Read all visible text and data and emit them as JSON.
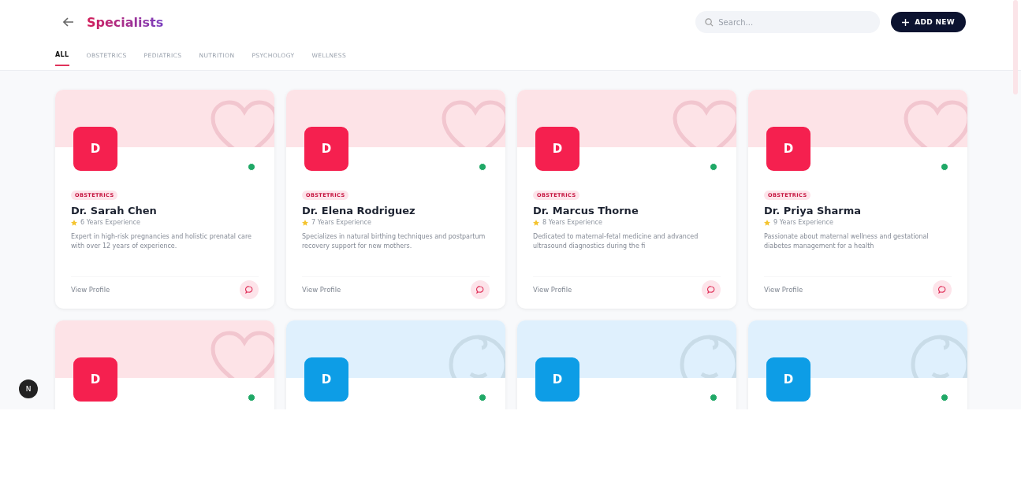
{
  "header": {
    "title": "Specialists",
    "search": {
      "placeholder": "Search..."
    },
    "add_button": "ADD NEW"
  },
  "tabs": [
    {
      "label": "ALL",
      "selected": true
    },
    {
      "label": "OBSTETRICS",
      "selected": false
    },
    {
      "label": "PEDIATRICS",
      "selected": false
    },
    {
      "label": "NUTRITION",
      "selected": false
    },
    {
      "label": "PSYCHOLOGY",
      "selected": false
    },
    {
      "label": "WELLNESS",
      "selected": false
    }
  ],
  "cards": [
    {
      "kind": "obstetrics",
      "initial": "D",
      "online": true,
      "tag": "OBSTETRICS",
      "name": "Dr. Sarah Chen",
      "experience": "6 Years Experience",
      "description": "Expert in high-risk pregnancies and holistic prenatal care with over 12 years of experience.",
      "link": "View Profile"
    },
    {
      "kind": "obstetrics",
      "initial": "D",
      "online": true,
      "tag": "OBSTETRICS",
      "name": "Dr. Elena Rodriguez",
      "experience": "7 Years Experience",
      "description": "Specializes in natural birthing techniques and postpartum recovery support for new mothers.",
      "link": "View Profile"
    },
    {
      "kind": "obstetrics",
      "initial": "D",
      "online": true,
      "tag": "OBSTETRICS",
      "name": "Dr. Marcus Thorne",
      "experience": "8 Years Experience",
      "description": "Dedicated to maternal-fetal medicine and advanced ultrasound diagnostics during the fi",
      "link": "View Profile"
    },
    {
      "kind": "obstetrics",
      "initial": "D",
      "online": true,
      "tag": "OBSTETRICS",
      "name": "Dr. Priya Sharma",
      "experience": "9 Years Experience",
      "description": "Passionate about maternal wellness and gestational diabetes management for a health",
      "link": "View Profile"
    },
    {
      "kind": "obstetrics",
      "initial": "D",
      "online": true
    },
    {
      "kind": "pediatrics",
      "initial": "D",
      "online": true
    },
    {
      "kind": "pediatrics",
      "initial": "D",
      "online": true
    },
    {
      "kind": "pediatrics",
      "initial": "D",
      "online": true
    }
  ],
  "dev_badge": "N"
}
